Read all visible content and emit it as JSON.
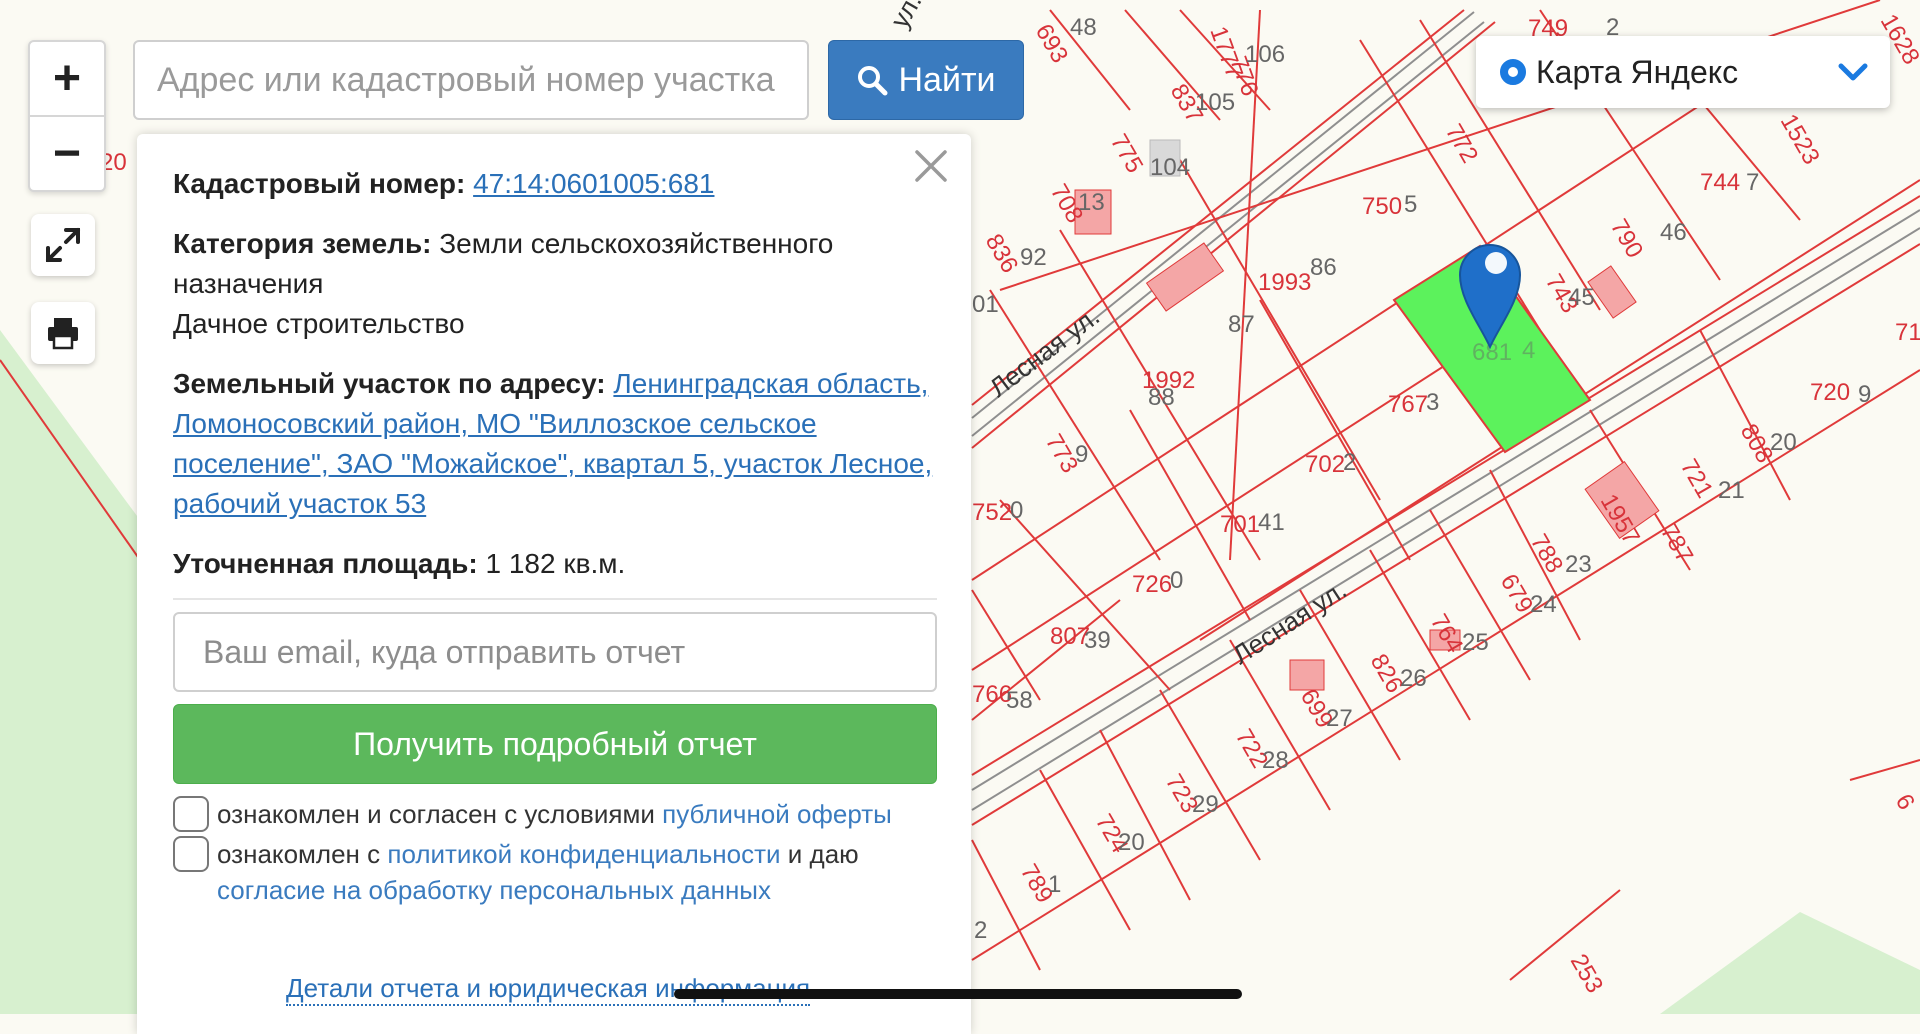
{
  "search": {
    "placeholder": "Адрес или кадастровый номер участка",
    "button_label": "Найти"
  },
  "zoom": {
    "plus": "+",
    "minus": "−"
  },
  "tools": {
    "fullscreen_icon": "expand-icon",
    "print_icon": "print-icon"
  },
  "layer_selector": {
    "label": "Карта Яндекс"
  },
  "panel": {
    "cadastral_label": "Кадастровый номер:",
    "cadastral_value": "47:14:0601005:681",
    "category_label": "Категория земель:",
    "category_value": "Земли сельскохозяйственного назначения",
    "usage": "Дачное строительство",
    "address_label": "Земельный участок по адресу:",
    "address_value": "Ленинградская область, Ломоносовский район, МО \"Виллозское сельское поселение\", ЗАО \"Можайское\", квартал 5, участок Лесное, рабочий участок 53",
    "area_label": "Уточненная площадь:",
    "area_value": "1 182 кв.м.",
    "email_placeholder": "Ваш email, куда отправить отчет",
    "report_button": "Получить подробный отчет",
    "consent1_text": "ознакомлен и согласен с условиями ",
    "consent1_link": "публичной оферты",
    "consent2_text": "ознакомлен с ",
    "consent2_link": "политикой конфиденциальности",
    "consent2_text2": " и даю ",
    "consent2_link2": "согласие на обработку персональных данных",
    "details_link": "Детали отчета и юридическая информация"
  },
  "map": {
    "street_labels": [
      "Лесная ул.",
      "Лесная ул.",
      "ул."
    ],
    "parcel_labels": [
      "693",
      "48",
      "1777",
      "776",
      "106",
      "837",
      "105",
      "775",
      "104",
      "708",
      "13",
      "836",
      "92",
      "1993",
      "86",
      "87",
      "1992",
      "88",
      "750",
      "5",
      "772",
      "749",
      "2",
      "744",
      "7",
      "1523",
      "790",
      "46",
      "743",
      "45",
      "767",
      "3",
      "702",
      "2",
      "773",
      "9",
      "701",
      "41",
      "726",
      "0",
      "720",
      "9",
      "808",
      "20",
      "721",
      "21",
      "1957",
      "787",
      "788",
      "23",
      "679",
      "24",
      "764",
      "25",
      "826",
      "26",
      "807",
      "39",
      "699",
      "27",
      "722",
      "28",
      "723",
      "29",
      "724",
      "20",
      "766",
      "58",
      "752",
      "0",
      "789",
      "1",
      "20",
      "01",
      "71",
      "253",
      "6",
      "1628",
      "2",
      "681",
      "4"
    ]
  },
  "colors": {
    "parcel_line": "#e03a3a",
    "selected_parcel": "#5cf25c",
    "accent": "#3a7bbf",
    "report_button": "#5cb85c",
    "marker": "#1f6fc9"
  }
}
